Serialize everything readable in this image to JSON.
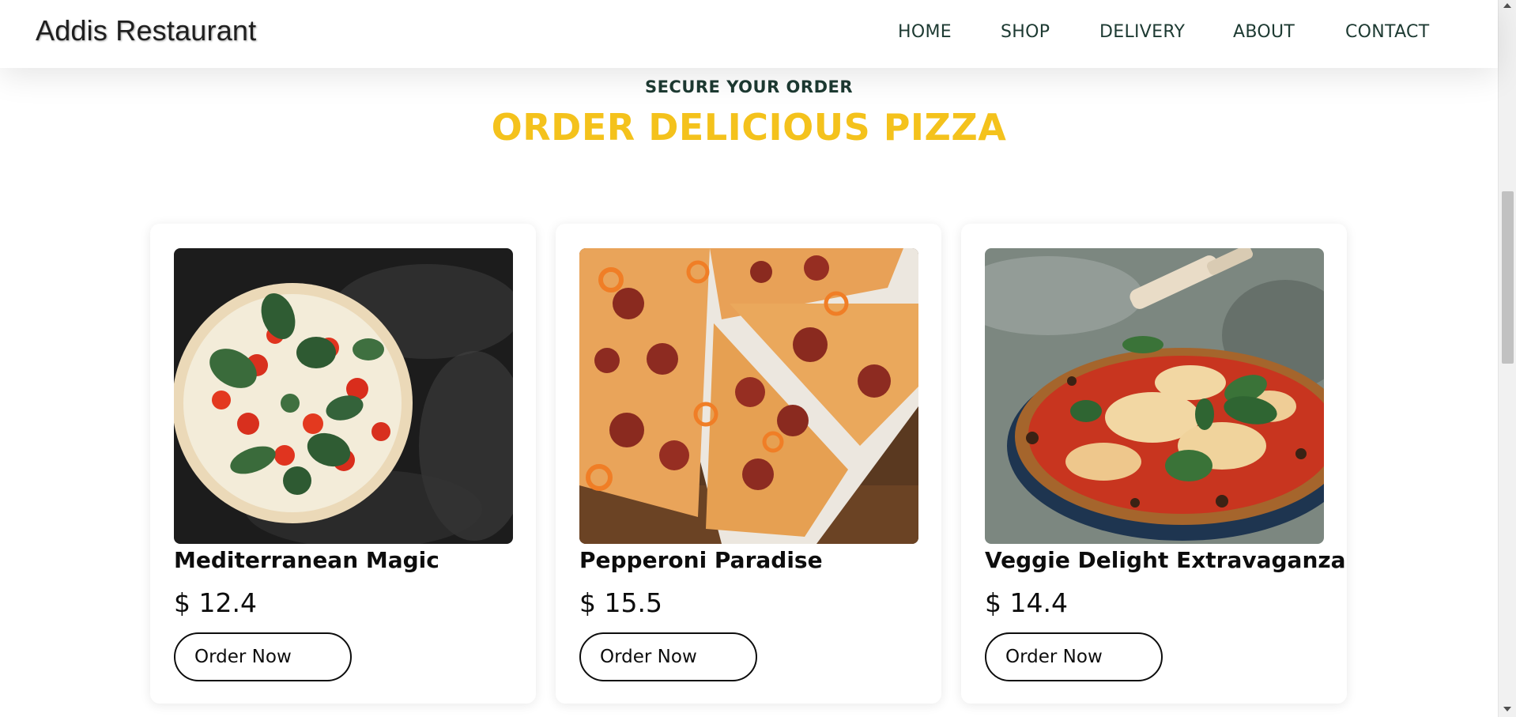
{
  "header": {
    "brand": "Addis Restaurant",
    "nav": [
      "HOME",
      "SHOP",
      "DELIVERY",
      "ABOUT",
      "CONTACT"
    ]
  },
  "section": {
    "subheading": "SECURE YOUR ORDER",
    "heading": "ORDER DELICIOUS PIZZA"
  },
  "products": [
    {
      "name": "Mediterranean Magic",
      "price": "$ 12.4",
      "button": "Order Now",
      "image": "pizza-margherita-photo"
    },
    {
      "name": "Pepperoni Paradise",
      "price": "$ 15.5",
      "button": "Order Now",
      "image": "pizza-pepperoni-photo"
    },
    {
      "name": "Veggie Delight Extravaganza",
      "price": "$ 14.4",
      "button": "Order Now",
      "image": "pizza-neapolitan-photo"
    }
  ],
  "colors": {
    "accent": "#f4c21c",
    "nav_text": "#1d3a32",
    "text": "#0d0d0d"
  }
}
